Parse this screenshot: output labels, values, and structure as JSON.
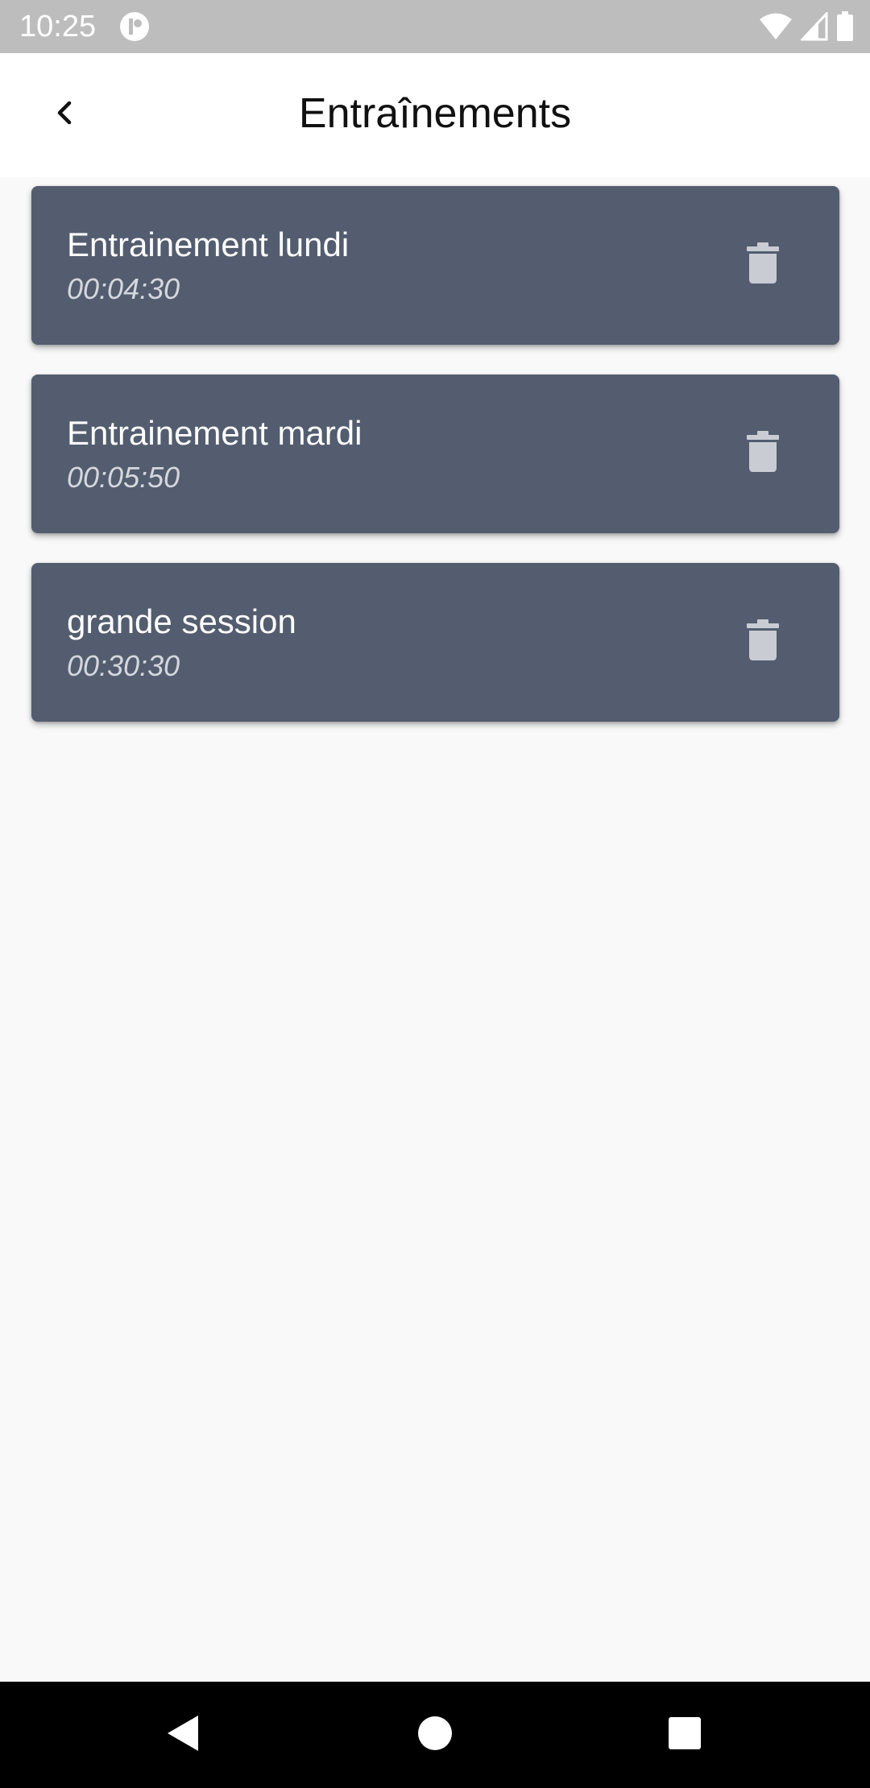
{
  "status_bar": {
    "time": "10:25",
    "icons": [
      "app-notification-icon",
      "wifi-icon",
      "signal-icon",
      "battery-icon"
    ]
  },
  "header": {
    "title": "Entraînements",
    "back_icon": "chevron-left-icon"
  },
  "workouts": [
    {
      "name": "Entrainement lundi",
      "duration": "00:04:30"
    },
    {
      "name": "Entrainement mardi",
      "duration": "00:05:50"
    },
    {
      "name": "grande session",
      "duration": "00:30:30"
    }
  ],
  "item_action_icon": "trash-icon",
  "nav_bar": {
    "icons": [
      "back-triangle-icon",
      "home-circle-icon",
      "recents-square-icon"
    ]
  },
  "colors": {
    "card": "#535d6f",
    "background": "#f9f9f9",
    "status_bar": "#bdbdbd",
    "nav_bar": "#000000"
  }
}
